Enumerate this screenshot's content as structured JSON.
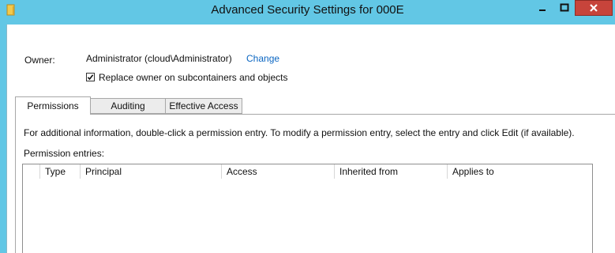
{
  "window": {
    "title": "Advanced Security Settings for 000E",
    "colors": {
      "frame": "#62c7e5",
      "close_button": "#c7443b",
      "link": "#0b66c2"
    },
    "icons": [
      "folder-icon",
      "minimize-icon",
      "maximize-icon",
      "close-icon"
    ]
  },
  "owner": {
    "label": "Owner:",
    "value": "Administrator (cloud\\Administrator)",
    "change_link": "Change",
    "replace_checkbox_label": "Replace owner on subcontainers and objects",
    "replace_checked": true
  },
  "tabs": [
    {
      "label": "Permissions",
      "active": true
    },
    {
      "label": "Auditing",
      "active": false
    },
    {
      "label": "Effective Access",
      "active": false
    }
  ],
  "permissions": {
    "info_text": "For additional information, double-click a permission entry. To modify a permission entry, select the entry and click Edit (if available).",
    "entries_label": "Permission entries:",
    "columns": [
      "Type",
      "Principal",
      "Access",
      "Inherited from",
      "Applies to"
    ],
    "rows": []
  }
}
